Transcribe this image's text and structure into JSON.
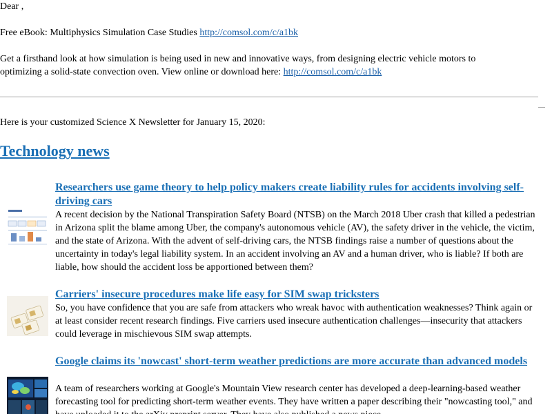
{
  "greeting": "Dear ,",
  "ad": {
    "line1_text": "Free eBook: Multiphysics Simulation Case Studies ",
    "line1_link": "http://comsol.com/c/a1bk",
    "line2": "Get a firsthand look at how simulation is being used in new and innovative ways, from designing electric vehicle motors to",
    "line3_text": "optimizing a solid-state convection oven. View online or download here: ",
    "line3_link": "http://comsol.com/c/a1bk"
  },
  "intro": "Here is your customized Science X Newsletter for January 15, 2020:",
  "section_title": "Technology news",
  "articles": [
    {
      "title": "Researchers use game theory to help policy makers create liability rules for accidents involving self-driving cars",
      "body": "A recent decision by the National Transpiration Safety Board (NTSB) on the March 2018 Uber crash that killed a pedestrian in Arizona split the blame among Uber, the company's autonomous vehicle (AV), the safety driver in the vehicle, the victim, and the state of Arizona. With the advent of self-driving cars, the NTSB findings raise a number of questions about the uncertainty in today's legal liability system. In an accident involving an AV and a human driver, who is liable? If both are liable, how should the accident loss be apportioned between them?",
      "thumb_icon": "game-theory-diagram-thumbnail"
    },
    {
      "title": "Carriers' insecure procedures make life easy for SIM swap tricksters",
      "body": "So, you have confidence that you are safe from attackers who wreak havoc with authentication weaknesses? Think again or at least consider recent research findings. Five carriers used insecure authentication challenges—insecurity that attackers could leverage in mischievous SIM swap attempts.",
      "thumb_icon": "sim-cards-thumbnail"
    },
    {
      "title": "Google claims its 'nowcast' short-term weather predictions are more accurate than advanced models",
      "body": "A team of researchers working at Google's Mountain View research center has developed a deep-learning-based weather forecasting tool for predicting short-term weather events. They have written a paper describing their \"nowcasting tool,\" and have uploaded it to the arXiv preprint server. They have also published a news piece",
      "thumb_icon": "weather-screens-thumbnail"
    }
  ]
}
